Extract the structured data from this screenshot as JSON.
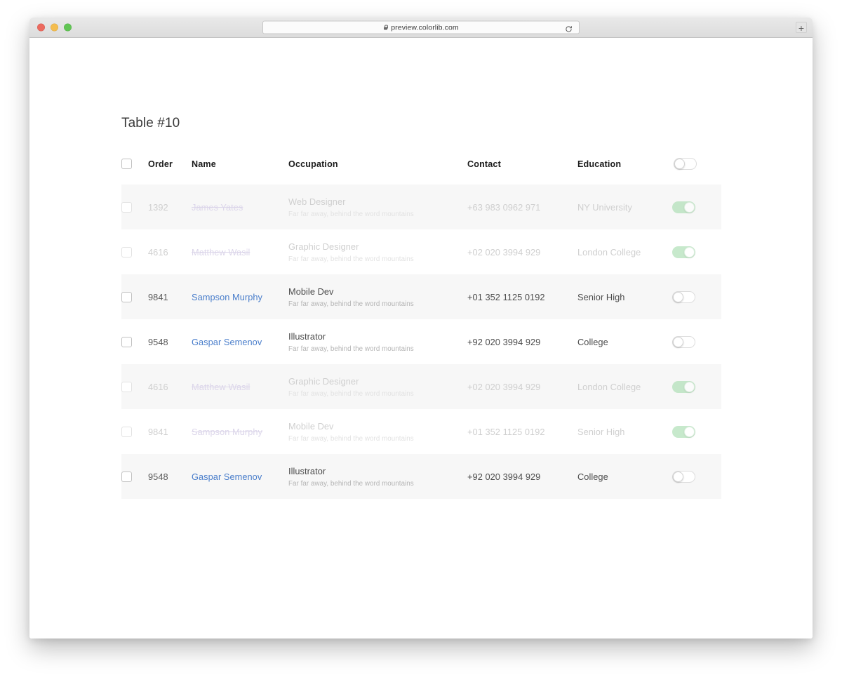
{
  "browser": {
    "url": "preview.colorlib.com",
    "lock_icon": "lock-icon",
    "reload_icon": "reload-icon",
    "new_tab_label": "+",
    "traffic_lights": [
      "close",
      "minimize",
      "maximize"
    ]
  },
  "page": {
    "title": "Table #10"
  },
  "table": {
    "select_all_checkbox": "unchecked",
    "header_toggle": "off",
    "columns": [
      {
        "key": "check",
        "label": ""
      },
      {
        "key": "order",
        "label": "Order"
      },
      {
        "key": "name",
        "label": "Name"
      },
      {
        "key": "occupation",
        "label": "Occupation"
      },
      {
        "key": "contact",
        "label": "Contact"
      },
      {
        "key": "education",
        "label": "Education"
      },
      {
        "key": "toggle",
        "label": ""
      }
    ],
    "rows": [
      {
        "order": "1392",
        "name": "James Yates",
        "name_struck": true,
        "occupation": "Web Designer",
        "occupation_sub": "Far far away, behind the word mountains",
        "contact": "+63 983 0962 971",
        "education": "NY University",
        "toggle": "on",
        "faded": true,
        "checked": false
      },
      {
        "order": "4616",
        "name": "Matthew Wasil",
        "name_struck": true,
        "occupation": "Graphic Designer",
        "occupation_sub": "Far far away, behind the word mountains",
        "contact": "+02 020 3994 929",
        "education": "London College",
        "toggle": "on",
        "faded": true,
        "checked": false
      },
      {
        "order": "9841",
        "name": "Sampson Murphy",
        "name_struck": false,
        "occupation": "Mobile Dev",
        "occupation_sub": "Far far away, behind the word mountains",
        "contact": "+01 352 1125 0192",
        "education": "Senior High",
        "toggle": "off",
        "faded": false,
        "checked": false
      },
      {
        "order": "9548",
        "name": "Gaspar Semenov",
        "name_struck": false,
        "occupation": "Illustrator",
        "occupation_sub": "Far far away, behind the word mountains",
        "contact": "+92 020 3994 929",
        "education": "College",
        "toggle": "off",
        "faded": false,
        "checked": false
      },
      {
        "order": "4616",
        "name": "Matthew Wasil",
        "name_struck": true,
        "occupation": "Graphic Designer",
        "occupation_sub": "Far far away, behind the word mountains",
        "contact": "+02 020 3994 929",
        "education": "London College",
        "toggle": "on",
        "faded": true,
        "checked": false
      },
      {
        "order": "9841",
        "name": "Sampson Murphy",
        "name_struck": true,
        "occupation": "Mobile Dev",
        "occupation_sub": "Far far away, behind the word mountains",
        "contact": "+01 352 1125 0192",
        "education": "Senior High",
        "toggle": "on",
        "faded": true,
        "checked": false
      },
      {
        "order": "9548",
        "name": "Gaspar Semenov",
        "name_struck": false,
        "occupation": "Illustrator",
        "occupation_sub": "Far far away, behind the word mountains",
        "contact": "+92 020 3994 929",
        "education": "College",
        "toggle": "off",
        "faded": false,
        "checked": false
      }
    ]
  },
  "colors": {
    "link_blue": "#4a7ecb",
    "struck_name": "#b9aad6",
    "toggle_on_green": "#a6dcae",
    "row_alt_bg": "#f7f7f7",
    "text_default": "#4c4c4c",
    "text_muted": "#b4b4b4",
    "text_faded": "#cfcfcf"
  }
}
